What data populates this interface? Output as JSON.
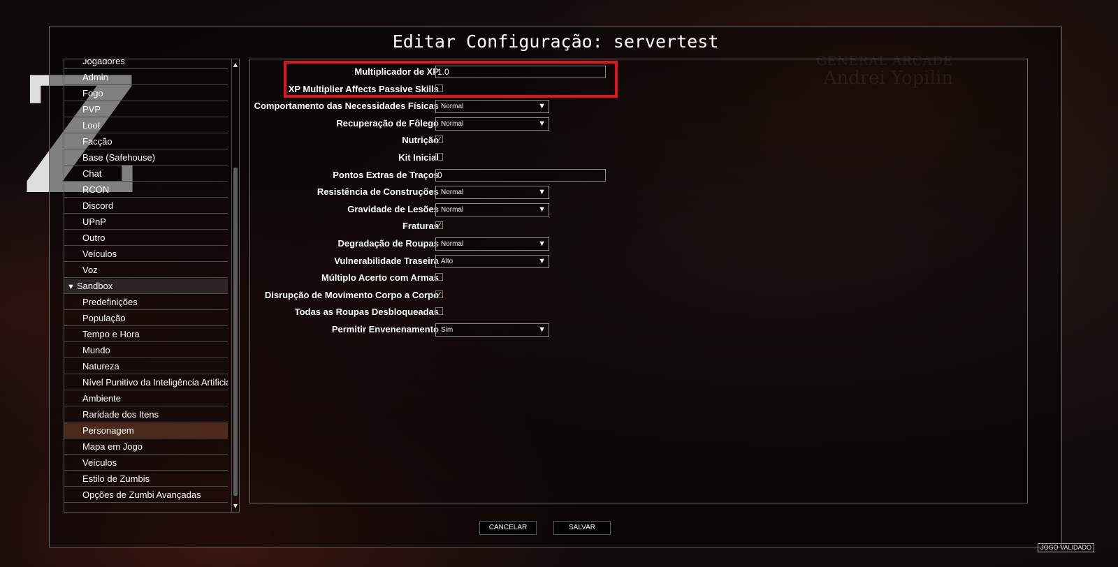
{
  "background": {
    "logo_letter": "Z",
    "credit_line1": "GENERAL ARCADE",
    "credit_line2": "Andrei Yopilin"
  },
  "dialog": {
    "title": "Editar Configuração: servertest"
  },
  "sidebar": {
    "items": [
      {
        "label": "Jogadores"
      },
      {
        "label": "Admin"
      },
      {
        "label": "Fogo"
      },
      {
        "label": "PVP"
      },
      {
        "label": "Loot"
      },
      {
        "label": "Facção"
      },
      {
        "label": "Base (Safehouse)"
      },
      {
        "label": "Chat"
      },
      {
        "label": "RCON"
      },
      {
        "label": "Discord"
      },
      {
        "label": "UPnP"
      },
      {
        "label": "Outro"
      },
      {
        "label": "Veículos"
      },
      {
        "label": "Voz"
      },
      {
        "label": "Sandbox",
        "header": true
      },
      {
        "label": "Predefinições"
      },
      {
        "label": "População"
      },
      {
        "label": "Tempo e Hora"
      },
      {
        "label": "Mundo"
      },
      {
        "label": "Natureza"
      },
      {
        "label": "Nível Punitivo da Inteligência Artificial"
      },
      {
        "label": "Ambiente"
      },
      {
        "label": "Raridade dos Itens"
      },
      {
        "label": "Personagem",
        "selected": true
      },
      {
        "label": "Mapa em Jogo"
      },
      {
        "label": "Veículos"
      },
      {
        "label": "Estilo de Zumbis"
      },
      {
        "label": "Opções de Zumbi Avançadas"
      }
    ]
  },
  "settings": [
    {
      "label": "Multiplicador de XP",
      "type": "text",
      "value": "1.0"
    },
    {
      "label": "XP Multiplier Affects Passive Skills",
      "type": "checkbox",
      "checked": false
    },
    {
      "label": "Comportamento das Necessidades Físicas",
      "type": "combo",
      "value": "Normal"
    },
    {
      "label": "Recuperação de Fôlego",
      "type": "combo",
      "value": "Normal"
    },
    {
      "label": "Nutrição",
      "type": "checkbox",
      "checked": true
    },
    {
      "label": "Kit Inicial",
      "type": "checkbox",
      "checked": false
    },
    {
      "label": "Pontos Extras de Traços",
      "type": "text",
      "value": "0"
    },
    {
      "label": "Resistência de Construções",
      "type": "combo",
      "value": "Normal"
    },
    {
      "label": "Gravidade de Lesões",
      "type": "combo",
      "value": "Normal"
    },
    {
      "label": "Fraturas",
      "type": "checkbox",
      "checked": true
    },
    {
      "label": "Degradação de Roupas",
      "type": "combo",
      "value": "Normal"
    },
    {
      "label": "Vulnerabilidade Traseira",
      "type": "combo",
      "value": "Alto"
    },
    {
      "label": "Múltiplo Acerto com Armas",
      "type": "checkbox",
      "checked": false
    },
    {
      "label": "Disrupção de Movimento Corpo a Corpo",
      "type": "checkbox",
      "checked": true
    },
    {
      "label": "Todas as Roupas Desbloqueadas",
      "type": "checkbox",
      "checked": false
    },
    {
      "label": "Permitir Envenenamento",
      "type": "combo",
      "value": "Sim"
    }
  ],
  "buttons": {
    "cancel": "CANCELAR",
    "save": "SALVAR"
  },
  "status": {
    "badge": "JOGO VALIDADO"
  },
  "colors": {
    "highlight": "#e0141a",
    "selected_row": "#784628"
  }
}
